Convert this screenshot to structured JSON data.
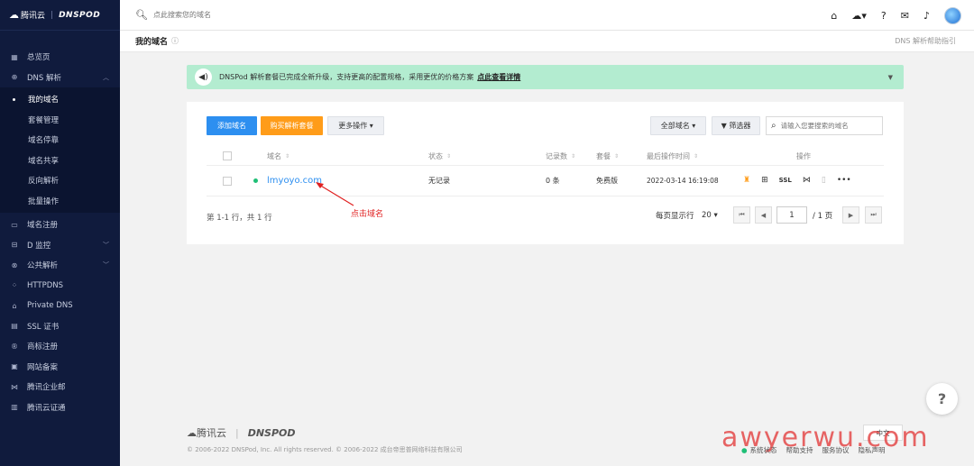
{
  "sidebar": {
    "logo_brand": "腾讯云",
    "logo_product": "DNSPOD",
    "items": [
      {
        "label": "总览页",
        "icon": "grid-icon"
      },
      {
        "label": "DNS 解析",
        "icon": "globe-icon",
        "expanded": true
      },
      {
        "label": "域名注册",
        "icon": "card-icon"
      },
      {
        "label": "D 监控",
        "icon": "monitor-icon"
      },
      {
        "label": "公共解析",
        "icon": "public-icon"
      },
      {
        "label": "HTTPDNS",
        "icon": "httpdns-icon"
      },
      {
        "label": "Private DNS",
        "icon": "lock-icon"
      },
      {
        "label": "SSL 证书",
        "icon": "cert-icon"
      },
      {
        "label": "商标注册",
        "icon": "trademark-icon"
      },
      {
        "label": "网站备案",
        "icon": "record-icon"
      },
      {
        "label": "腾讯企业邮",
        "icon": "mail-icon"
      },
      {
        "label": "腾讯云证通",
        "icon": "id-icon"
      }
    ],
    "subitems": [
      "我的域名",
      "套餐管理",
      "域名停靠",
      "域名共享",
      "反向解析",
      "批量操作"
    ]
  },
  "topbar": {
    "search_placeholder": "点此搜索您的域名"
  },
  "page": {
    "title": "我的域名",
    "help_link": "DNS 解析帮助指引"
  },
  "notice": {
    "text": "DNSPod 解析套餐已完成全新升级，支持更高的配置规格，采用更优的价格方案",
    "link": "点此查看详情"
  },
  "toolbar": {
    "add_label": "添加域名",
    "buy_label": "购买解析套餐",
    "more_label": "更多操作 ▾",
    "all_label": "全部域名 ▾",
    "filter_label": "▼ 筛选器",
    "search_placeholder": "请输入您要搜索的域名"
  },
  "table": {
    "headers": {
      "domain": "域名",
      "status": "状态",
      "records": "记录数",
      "plan": "套餐",
      "last_op": "最后操作时间",
      "actions": "操作"
    },
    "rows": [
      {
        "domain": "lmyoyo.com",
        "status": "无记录",
        "records": "0 条",
        "plan": "免费版",
        "last_op": "2022-03-14 16:19:08"
      }
    ],
    "total": "第 1-1 行，共 1 行"
  },
  "pagination": {
    "per_page_label": "每页显示行",
    "per_page_value": "20 ▾",
    "current_page": "1",
    "total_pages": "/ 1 页"
  },
  "annotation": "点击域名",
  "footer": {
    "brand": "腾讯云",
    "product": "DNSPOD",
    "copyright": "© 2006-2022 DNSPod, Inc. All rights reserved. © 2006-2022 成台帝思普网络科技有限公司",
    "status_link": "系统状态",
    "help_link": "帮助支持",
    "service_link": "服务协议",
    "privacy_link": "隐私声明",
    "language": "中文"
  },
  "help_fab": "?",
  "watermark": "awyerwu.com",
  "colors": {
    "primary": "#2d8ff0",
    "accent": "#ff9c19",
    "sidebar_bg": "#101b3d",
    "notice_bg": "#b3ecd0",
    "status_green": "#1fbf76",
    "annotation_red": "#e02020"
  }
}
